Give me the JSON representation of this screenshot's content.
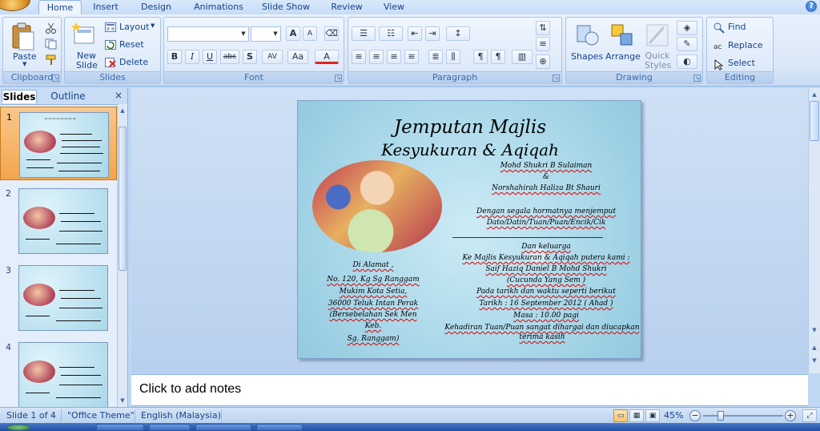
{
  "ribbon": {
    "tabs": [
      {
        "label": "Home",
        "active": true
      },
      {
        "label": "Insert"
      },
      {
        "label": "Design"
      },
      {
        "label": "Animations"
      },
      {
        "label": "Slide Show"
      },
      {
        "label": "Review"
      },
      {
        "label": "View"
      }
    ],
    "help_label": "?",
    "groups": {
      "clipboard": {
        "label": "Clipboard",
        "paste": "Paste"
      },
      "slides": {
        "label": "Slides",
        "new_slide": "New Slide",
        "layout": "Layout",
        "reset": "Reset",
        "delete": "Delete"
      },
      "font": {
        "label": "Font",
        "bold": "B",
        "italic": "I",
        "underline": "U",
        "strike": "abc",
        "shadow": "S",
        "spacing": "AV",
        "case": "Aa",
        "color": "A",
        "grow": "A",
        "shrink": "A"
      },
      "paragraph": {
        "label": "Paragraph"
      },
      "drawing": {
        "label": "Drawing",
        "shapes": "Shapes",
        "arrange": "Arrange",
        "quick_styles": "Quick Styles"
      },
      "editing": {
        "label": "Editing",
        "find": "Find",
        "replace": "Replace",
        "select": "Select"
      }
    }
  },
  "left_panel": {
    "tabs": [
      {
        "label": "Slides",
        "active": true
      },
      {
        "label": "Outline"
      }
    ],
    "close": "×",
    "thumbnails": [
      {
        "number": "1",
        "selected": true
      },
      {
        "number": "2"
      },
      {
        "number": "3"
      },
      {
        "number": "4"
      }
    ]
  },
  "slide": {
    "title1": "Jemputan Majlis",
    "title2": "Kesyukuran & Aqiqah",
    "hosts": [
      "Mohd Shukri B Sulaiman",
      "&",
      "Norshahirah Haliza Bt Shauri"
    ],
    "invite": [
      "Dengan segala hormatnya menjemput",
      "Dato/Datin/Tuan/Puan/Encik/Cik"
    ],
    "family": [
      "Dan keluarga",
      "Ke Majlis Kesyukuran & Aqiqah putera kami :",
      "Saif Haziq Daniel B Mohd Shukri",
      "(Cucunda Yang Sem )",
      "Pada tarikh dan waktu seperti berikut",
      "Tarikh : 16 September 2012 ( Ahad )",
      "Masa : 10.00 pagi",
      "Kehadiran Tuan/Puan sangat dihargai dan diucapkan",
      "terima kasih"
    ],
    "address": [
      "Di Alamat ,",
      "No. 120, Kg Sg Ranggam",
      "Mukim Kota Setia,",
      "36000 Teluk Intan Perak",
      "(Bersebelahan Sek Men",
      "Keb.",
      "Sg. Ranggam)"
    ]
  },
  "notes": {
    "placeholder": "Click to add notes"
  },
  "status": {
    "slide_info": "Slide 1 of 4",
    "theme": "\"Office Theme\"",
    "language": "English (Malaysia)",
    "zoom": "45%",
    "zoom_minus": "−",
    "zoom_plus": "+"
  }
}
